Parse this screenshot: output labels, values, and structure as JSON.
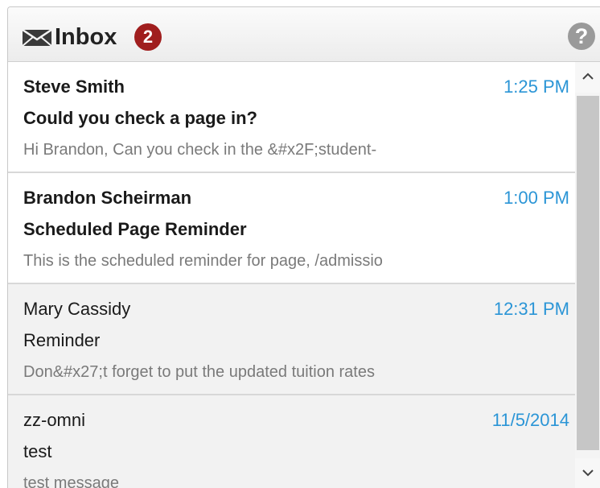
{
  "header": {
    "title": "Inbox",
    "unread_count": "2",
    "help_label": "?"
  },
  "messages": [
    {
      "sender": "Steve Smith",
      "time": "1:25 PM",
      "subject": "Could you check a page in?",
      "preview": "Hi Brandon, Can you check in the &#x2F;student-",
      "unread": true
    },
    {
      "sender": "Brandon Scheirman",
      "time": "1:00 PM",
      "subject": "Scheduled Page Reminder",
      "preview": "This is the scheduled reminder for page, /admissio",
      "unread": true
    },
    {
      "sender": "Mary Cassidy",
      "time": "12:31 PM",
      "subject": "Reminder",
      "preview": "Don&#x27;t forget to put the updated tuition rates",
      "unread": false
    },
    {
      "sender": "zz-omni",
      "time": "11/5/2014",
      "subject": "test",
      "preview": "test message",
      "unread": false
    }
  ],
  "colors": {
    "badge": "#a01e1e",
    "time": "#2b95d6",
    "read_background": "#f2f2f2"
  },
  "icons": {
    "mail": "envelope-icon",
    "help": "help-icon",
    "scroll_up": "chevron-up-icon",
    "scroll_down": "chevron-down-icon"
  }
}
